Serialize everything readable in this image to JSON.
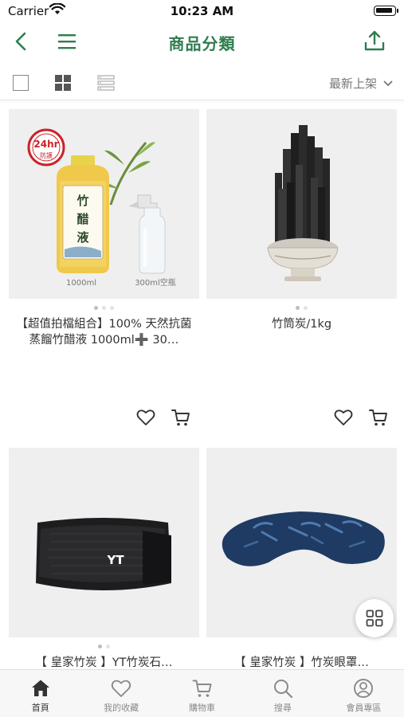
{
  "status_bar": {
    "carrier": "Carrier",
    "time": "10:23 AM"
  },
  "header": {
    "title": "商品分類",
    "back_icon": "chevron-left-icon",
    "menu_icon": "hamburger-icon",
    "share_icon": "share-icon"
  },
  "toolbar": {
    "sort_label": "最新上架"
  },
  "products": [
    {
      "name": "【超值拍檔組合】100% 天然抗菌蒸餾竹醋液  1000ml➕ 30…",
      "img_labels": [
        "24hr",
        "防護",
        "竹",
        "醋",
        "液",
        "1000ml",
        "300ml空瓶"
      ],
      "dots": 3,
      "active_dot": 0
    },
    {
      "name": "竹筒炭/1kg",
      "dots": 2,
      "active_dot": 0
    },
    {
      "name": "【 皇家竹炭 】YT竹炭石…",
      "img_labels": [
        "YT"
      ],
      "dots": 2,
      "active_dot": 0
    },
    {
      "name": "【 皇家竹炭 】竹炭眼罩…"
    }
  ],
  "tabs": [
    {
      "label": "首頁",
      "icon": "home-icon",
      "active": true
    },
    {
      "label": "我的收藏",
      "icon": "heart-icon",
      "active": false
    },
    {
      "label": "購物車",
      "icon": "cart-icon",
      "active": false
    },
    {
      "label": "搜尋",
      "icon": "search-icon",
      "active": false
    },
    {
      "label": "會員專區",
      "icon": "user-icon",
      "active": false
    }
  ],
  "colors": {
    "accent": "#2e7d4f",
    "tab_active": "#333333",
    "tab_inactive": "#8a8a8a"
  }
}
